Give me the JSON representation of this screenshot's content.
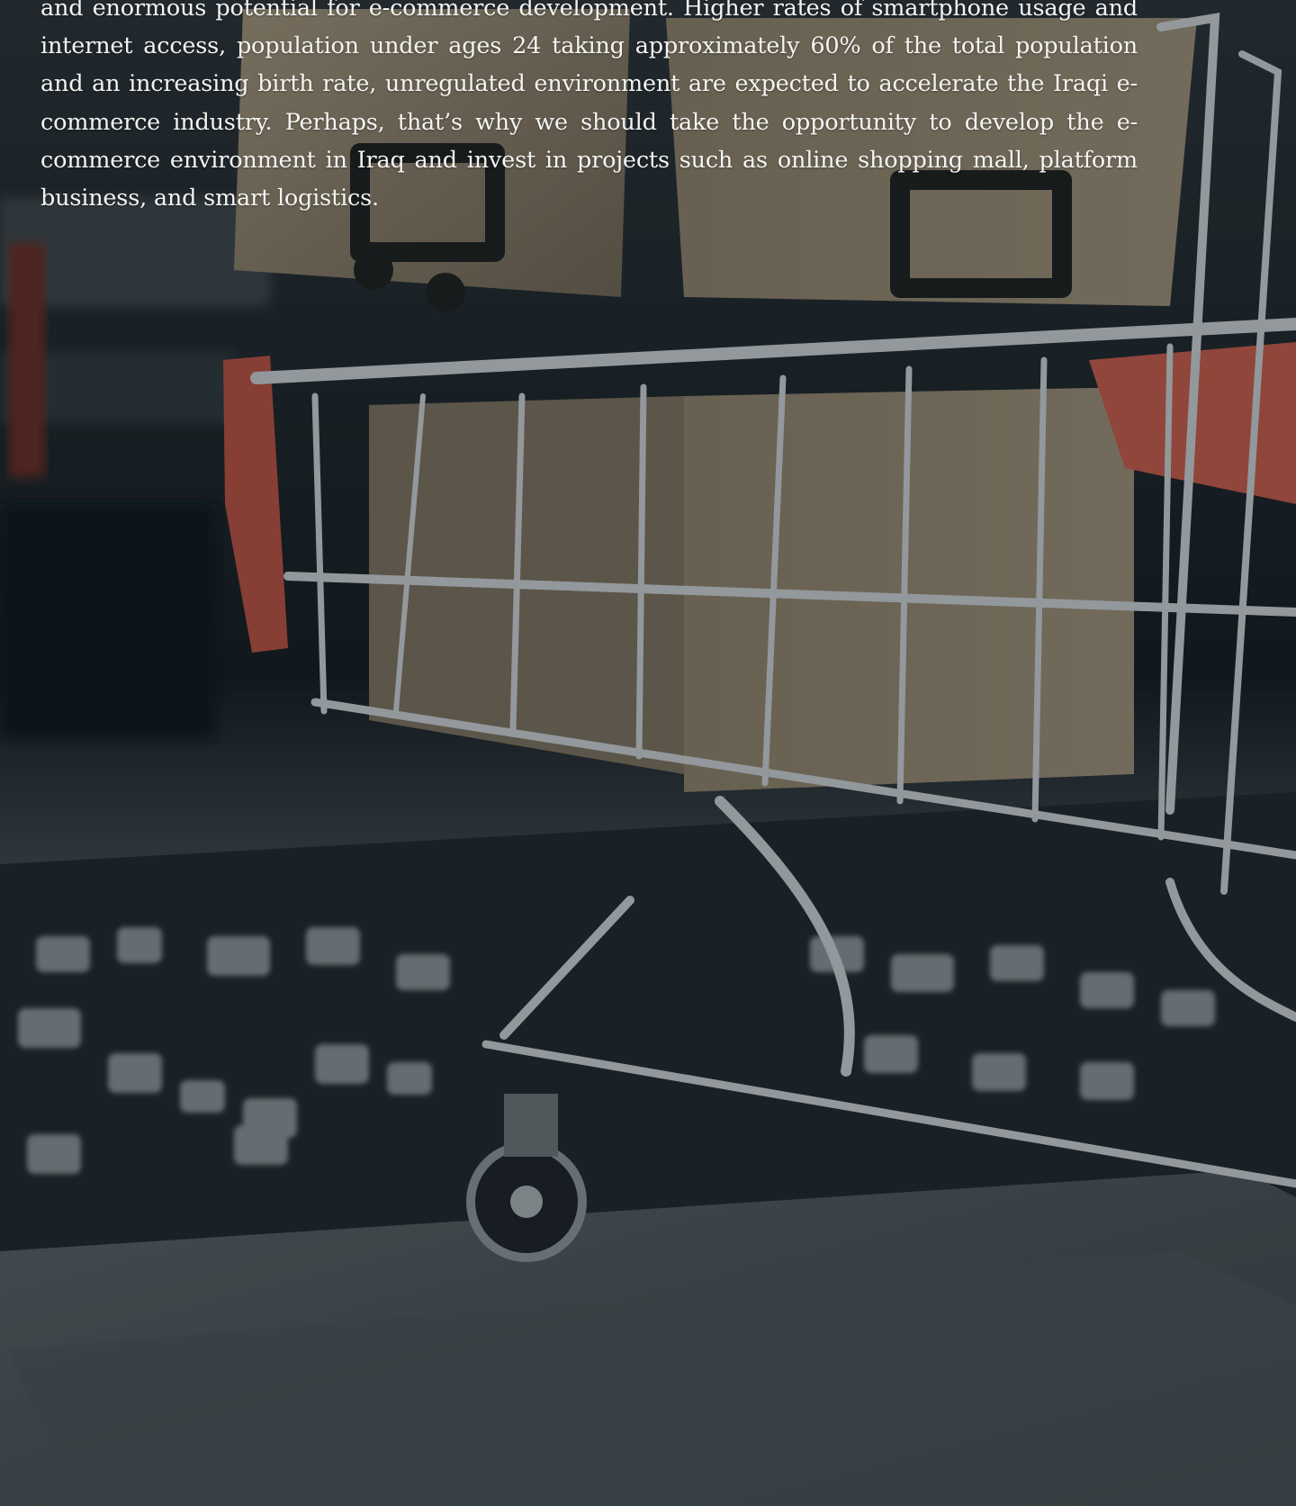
{
  "article": {
    "paragraph": "and enormous potential for e-commerce development. Higher rates of smartphone usage and internet access, population under ages 24 taking approximately 60% of the total population and an increasing birth rate, unregulated environment are expected to accelerate the Iraqi e-commerce industry. Perhaps, that’s why we should take the opportunity to develop the e-commerce environment in Iraq and invest in projects such as online shopping mall, platform business, and smart logistics."
  },
  "background": {
    "image": "shopping-cart-on-laptop-photo",
    "colors": {
      "dark": "#0d1418",
      "cardboard": "#8a7d66",
      "chrome": "#b9bfc2",
      "accent_red": "#b8503f",
      "laptop_gray": "#4a5256"
    }
  }
}
